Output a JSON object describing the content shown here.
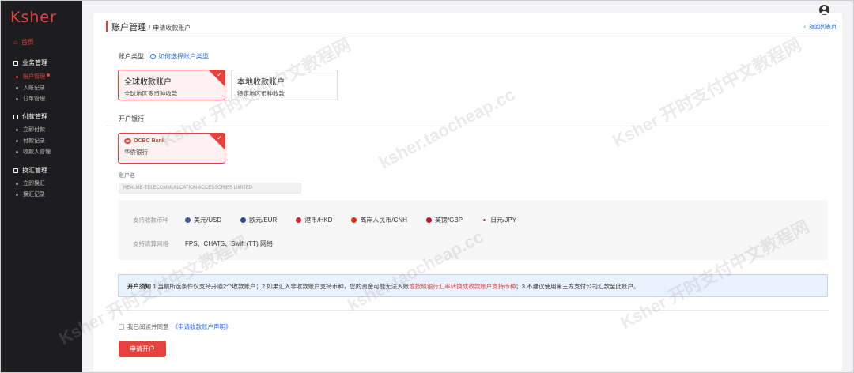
{
  "app": {
    "logo": "Ksher"
  },
  "sidebar": {
    "home": "首页",
    "groups": [
      {
        "label": "业务管理",
        "items": [
          "账户管理",
          "入账记录",
          "订单管理"
        ]
      },
      {
        "label": "付款管理",
        "items": [
          "立即付款",
          "付款记录",
          "收款人管理"
        ]
      },
      {
        "label": "换汇管理",
        "items": [
          "立即换汇",
          "换汇记录"
        ]
      }
    ]
  },
  "header": {
    "title": "账户管理",
    "separator": "/",
    "subtitle": "申请收款账户",
    "back": "返回列表页"
  },
  "account_type": {
    "label": "账户类型",
    "help": "如何选择账户类型",
    "options": [
      {
        "title": "全球收款账户",
        "desc": "全球地区多币种收款",
        "selected": true
      },
      {
        "title": "本地收款账户",
        "desc": "特定地区币种收款",
        "selected": false
      }
    ]
  },
  "bank": {
    "label": "开户银行",
    "logo_text": "OCBC Bank",
    "name": "华侨银行"
  },
  "account_name": {
    "label": "账户名",
    "value": "REALME-TELECOMMUNICATION ACCESSORIES LIMITED"
  },
  "info": {
    "currencies_label": "支持收款币种",
    "currencies": [
      {
        "label": "美元/USD",
        "color": "#3c5a9a"
      },
      {
        "label": "欧元/EUR",
        "color": "#2b4a8c"
      },
      {
        "label": "港币/HKD",
        "color": "#d8252c"
      },
      {
        "label": "离岸人民币/CNH",
        "color": "#de2910"
      },
      {
        "label": "英镑/GBP",
        "color": "#c8102e"
      },
      {
        "label": "日元/JPY",
        "color": "#bc002d"
      }
    ],
    "networks_label": "支持清算网络",
    "networks": "FPS、CHATS、Swift (TT) 网络"
  },
  "notice": {
    "heading": "开户须知",
    "text1": "1.当前所选条件仅支持开通2个收款账户；2.如果汇入非收款账户支持币种，您的资金可能无法入账",
    "text_red": "或按照银行汇率转换成收款账户支持币种",
    "text2": "；3.不建议使用第三方支付公司汇款至此账户。"
  },
  "agree": {
    "label": "我已阅读并同意",
    "link": "《申请收款账户声明》"
  },
  "submit": "申请开户",
  "watermarks": [
    "Ksher 开时支付中文教程网",
    "ksher.taocheap.cc"
  ],
  "colors": {
    "accent": "#e6403f",
    "link": "#2c6fd6",
    "sidebar": "#1d1d1f"
  }
}
